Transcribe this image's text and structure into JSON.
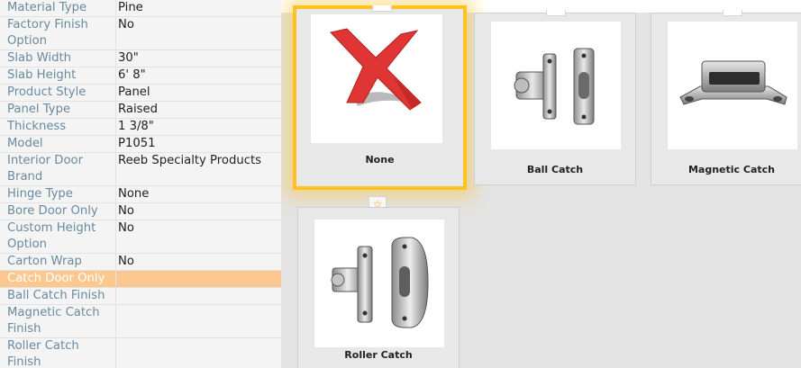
{
  "properties": [
    {
      "label": "Material Type",
      "value": "Pine"
    },
    {
      "label": "Factory Finish Option",
      "value": "No"
    },
    {
      "label": "Slab Width",
      "value": "30\""
    },
    {
      "label": "Slab Height",
      "value": "6' 8\""
    },
    {
      "label": "Product Style",
      "value": "Panel"
    },
    {
      "label": "Panel Type",
      "value": "Raised"
    },
    {
      "label": "Thickness",
      "value": "1 3/8\""
    },
    {
      "label": "Model",
      "value": "P1051"
    },
    {
      "label": "Interior Door Brand",
      "value": "Reeb Specialty Products"
    },
    {
      "label": "Hinge Type",
      "value": "None"
    },
    {
      "label": "Bore Door Only",
      "value": "No"
    },
    {
      "label": "Custom Height Option",
      "value": "No"
    },
    {
      "label": "Carton Wrap",
      "value": "No"
    },
    {
      "label": "Catch Door Only",
      "value": ""
    },
    {
      "label": "Ball Catch Finish",
      "value": ""
    },
    {
      "label": "Magnetic Catch Finish",
      "value": ""
    },
    {
      "label": "Roller Catch Finish",
      "value": ""
    }
  ],
  "selected_property": "Catch Door Only",
  "options": [
    {
      "label": "None",
      "icon": "none-x-icon",
      "selected": true
    },
    {
      "label": "Ball Catch",
      "icon": "ball-catch-icon",
      "selected": false
    },
    {
      "label": "Magnetic Catch",
      "icon": "magnetic-catch-icon",
      "selected": false
    },
    {
      "label": "Roller Catch",
      "icon": "roller-catch-icon",
      "selected": false
    }
  ],
  "favorite_icon": "star-icon",
  "colors": {
    "highlight_row": "#fcc88f",
    "selection_border": "#ffc21f",
    "x_red": "#e03535"
  }
}
